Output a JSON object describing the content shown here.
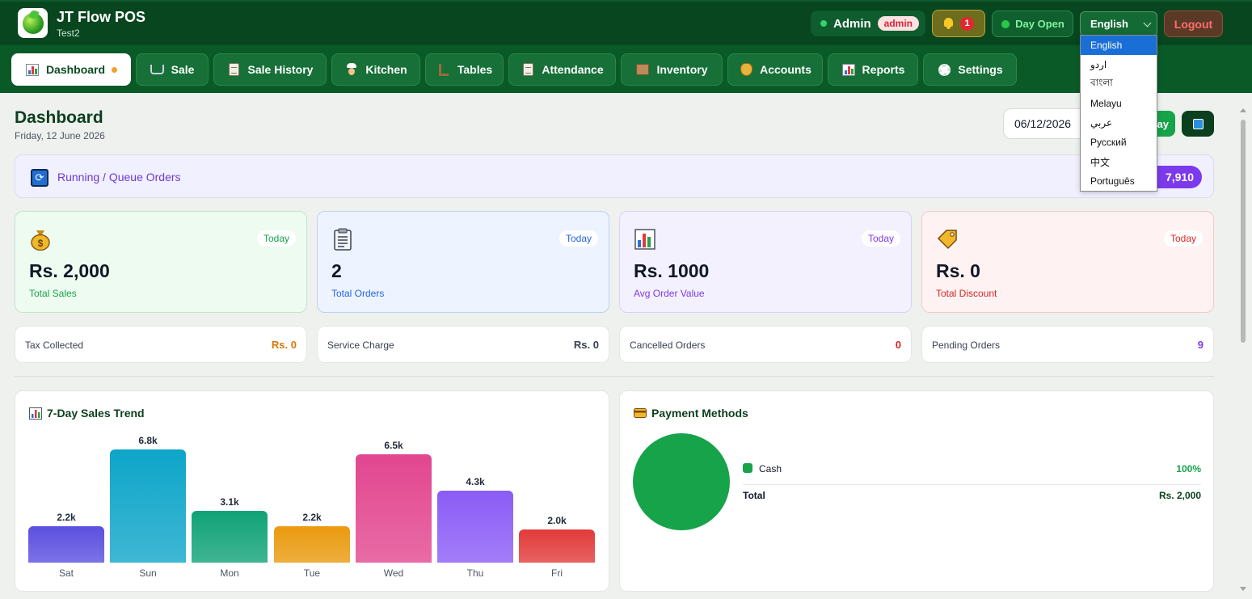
{
  "header": {
    "app_title": "JT Flow POS",
    "app_subtitle": "Test2",
    "user_name": "Admin",
    "user_role": "admin",
    "notification_count": "1",
    "day_status": "Day Open",
    "language_selected": "English",
    "logout_label": "Logout"
  },
  "nav": {
    "tabs": [
      {
        "label": "Dashboard",
        "icon": "chart-icon",
        "active": true
      },
      {
        "label": "Sale",
        "icon": "cart-icon"
      },
      {
        "label": "Sale History",
        "icon": "scroll-icon"
      },
      {
        "label": "Kitchen",
        "icon": "chef-icon"
      },
      {
        "label": "Tables",
        "icon": "chair-icon"
      },
      {
        "label": "Attendance",
        "icon": "clipboard-icon"
      },
      {
        "label": "Inventory",
        "icon": "box-icon"
      },
      {
        "label": "Accounts",
        "icon": "money-bag-icon"
      },
      {
        "label": "Reports",
        "icon": "chart-icon"
      },
      {
        "label": "Settings",
        "icon": "gear-icon"
      }
    ]
  },
  "page": {
    "title": "Dashboard",
    "date": "Friday, 12 June 2026",
    "date_input": "06/12/2026",
    "today_label": "ay"
  },
  "queue": {
    "label": "Running / Queue Orders",
    "total": "7,910"
  },
  "stats": [
    {
      "value": "Rs. 2,000",
      "label": "Total Sales",
      "tag": "Today",
      "icon": "money-bag-icon",
      "accent": "#16a34a"
    },
    {
      "value": "2",
      "label": "Total Orders",
      "tag": "Today",
      "icon": "clipboard-icon",
      "accent": "#2563eb"
    },
    {
      "value": "Rs. 1000",
      "label": "Avg Order Value",
      "tag": "Today",
      "icon": "bar-chart-icon",
      "accent": "#7c3aed"
    },
    {
      "value": "Rs. 0",
      "label": "Total Discount",
      "tag": "Today",
      "icon": "price-tag-icon",
      "accent": "#dc2626"
    }
  ],
  "mini_stats": [
    {
      "label": "Tax Collected",
      "value": "Rs. 0",
      "color": "#d97706"
    },
    {
      "label": "Service Charge",
      "value": "Rs. 0",
      "color": "#374151"
    },
    {
      "label": "Cancelled Orders",
      "value": "0",
      "color": "#dc2626"
    },
    {
      "label": "Pending Orders",
      "value": "9",
      "color": "#7c3aed"
    }
  ],
  "sales_panel": {
    "title": "7-Day Sales Trend"
  },
  "payment_panel": {
    "title": "Payment Methods",
    "method_name": "Cash",
    "method_pct": "100%",
    "total_label": "Total",
    "total_value": "Rs. 2,000"
  },
  "chart_data": {
    "type": "bar",
    "title": "7-Day Sales Trend",
    "categories": [
      "Sat",
      "Sun",
      "Mon",
      "Tue",
      "Wed",
      "Thu",
      "Fri"
    ],
    "values": [
      2200,
      6800,
      3100,
      2200,
      6500,
      4300,
      2000
    ],
    "data_labels": [
      "2.2k",
      "6.8k",
      "3.1k",
      "2.2k",
      "6.5k",
      "4.3k",
      "2.0k"
    ],
    "colors": [
      "#5b4fe0",
      "#0ea5c9",
      "#10a277",
      "#ea9a0e",
      "#e2468f",
      "#8b5cf6",
      "#e23a3a"
    ],
    "grid": false
  },
  "language_menu": {
    "options": [
      "English",
      "اردو",
      "বাংলা",
      "Melayu",
      "عربي",
      "Русский",
      "中文",
      "Português"
    ],
    "selected": "English"
  }
}
